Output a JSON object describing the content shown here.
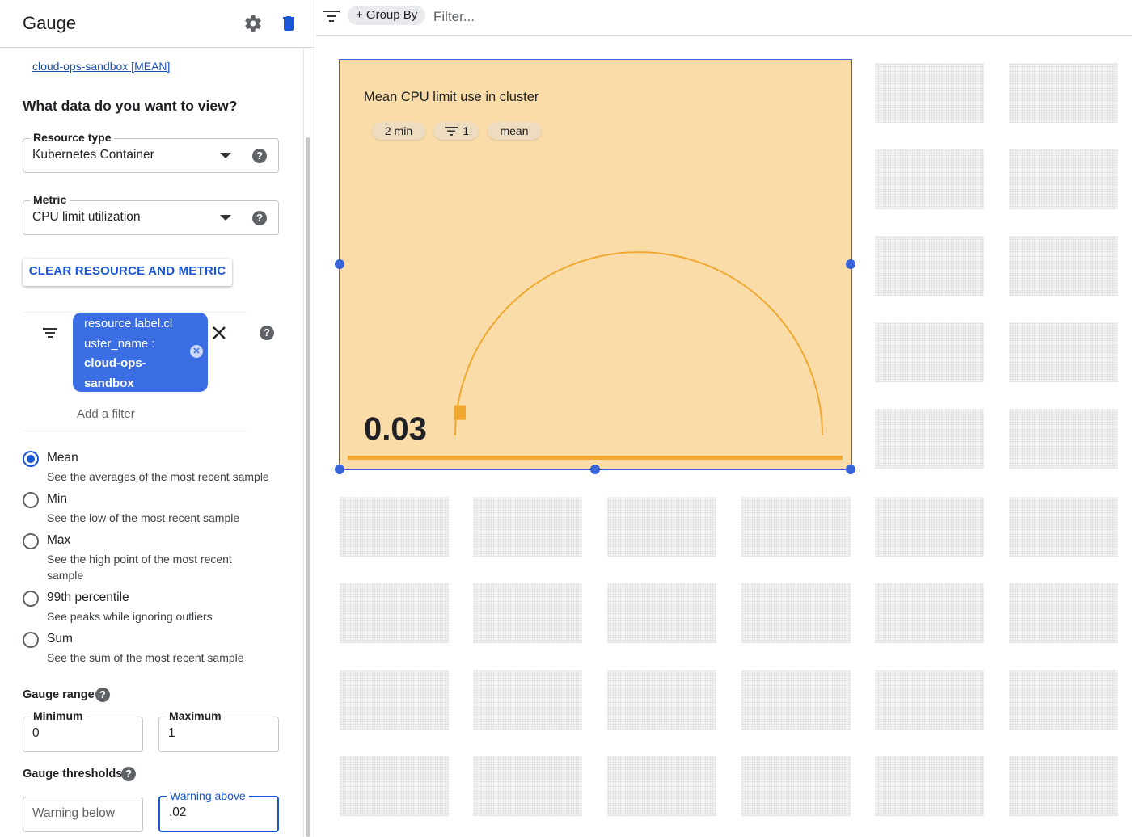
{
  "panel": {
    "title": "Gauge",
    "breadcrumb": "cloud-ops-sandbox [MEAN]",
    "question": "What data do you want to view?",
    "resource_type": {
      "label": "Resource type",
      "value": "Kubernetes Container"
    },
    "metric": {
      "label": "Metric",
      "value": "CPU limit utilization"
    },
    "clear_button": "CLEAR RESOURCE AND METRIC",
    "filter_chip": {
      "line1": "resource.label.cl",
      "line2": "uster_name :",
      "line3": "cloud-ops-",
      "line4": "sandbox"
    },
    "add_filter": "Add a filter",
    "aggregations": [
      {
        "label": "Mean",
        "desc": "See the averages of the most recent sample",
        "selected": true
      },
      {
        "label": "Min",
        "desc": "See the low of the most recent sample",
        "selected": false
      },
      {
        "label": "Max",
        "desc": "See the high point of the most recent sample",
        "selected": false
      },
      {
        "label": "99th percentile",
        "desc": "See peaks while ignoring outliers",
        "selected": false
      },
      {
        "label": "Sum",
        "desc": "See the sum of the most recent sample",
        "selected": false
      }
    ],
    "gauge_range": {
      "heading": "Gauge range",
      "min_label": "Minimum",
      "min_value": "0",
      "max_label": "Maximum",
      "max_value": "1"
    },
    "gauge_thresholds": {
      "heading": "Gauge thresholds",
      "warning_below_placeholder": "Warning below",
      "warning_above_label": "Warning above",
      "warning_above_value": ".02"
    }
  },
  "toolbar": {
    "group_by": "+ Group By",
    "filter_placeholder": "Filter..."
  },
  "widget": {
    "title": "Mean CPU limit use in cluster",
    "chips": {
      "period": "2 min",
      "filter_count": "1",
      "aggregation": "mean"
    },
    "value": "0.03",
    "gauge_min": 0,
    "gauge_max": 1,
    "gauge_value": 0.03,
    "warning_above": 0.02
  },
  "colors": {
    "accent": "#1a56d6",
    "widget_bg": "#f9dca8",
    "gauge_arc": "#f0a830",
    "selection": "#3762d8"
  }
}
